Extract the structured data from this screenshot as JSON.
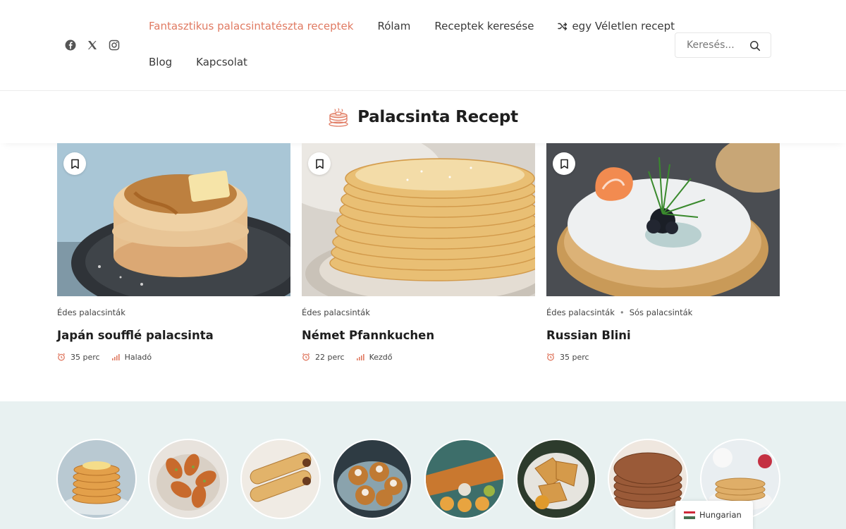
{
  "header": {
    "social": [
      {
        "icon": "facebook-icon"
      },
      {
        "icon": "x-twitter-icon"
      },
      {
        "icon": "instagram-icon"
      }
    ],
    "nav_row1": [
      {
        "label": "Fantasztikus palacsintatészta receptek",
        "active": true
      },
      {
        "label": "Rólam"
      },
      {
        "label": "Receptek keresése"
      },
      {
        "label": "egy Véletlen recept",
        "icon": "shuffle-icon"
      }
    ],
    "nav_row2": [
      {
        "label": "Blog"
      },
      {
        "label": "Kapcsolat"
      }
    ],
    "search": {
      "placeholder": "Keresés...",
      "value": ""
    },
    "accent_color": "#e07a62"
  },
  "section": {
    "title": "Palacsinta Recept",
    "icon": "pancake-stack-icon"
  },
  "cards": [
    {
      "categories": [
        "Édes palacsinták"
      ],
      "title": "Japán soufflé palacsinta",
      "time": "35 perc",
      "difficulty": "Haladó"
    },
    {
      "categories": [
        "Édes palacsinták"
      ],
      "title": "Német Pfannkuchen",
      "time": "22 perc",
      "difficulty": "Kezdő"
    },
    {
      "categories": [
        "Édes palacsinták",
        "Sós palacsinták"
      ],
      "title": "Russian Blini",
      "time": "35 perc",
      "difficulty": ""
    }
  ],
  "language": {
    "label": "Hungarian",
    "flag_colors": [
      "#ce2939",
      "#ffffff",
      "#477050"
    ]
  }
}
